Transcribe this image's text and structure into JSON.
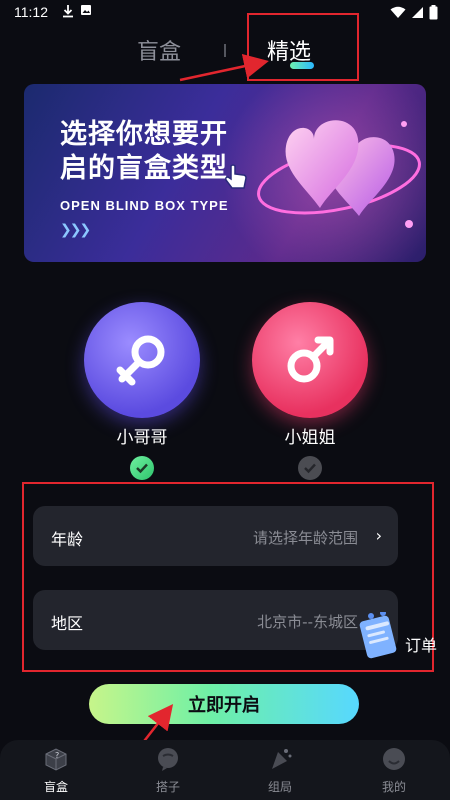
{
  "status_bar": {
    "time": "11:12",
    "icons": [
      "download-icon",
      "image-icon",
      "wifi-icon",
      "signal-icon",
      "battery-icon"
    ]
  },
  "top_tabs": {
    "blind_box": "盲盒",
    "selected": "精选",
    "active": "selected"
  },
  "banner": {
    "title_line1": "选择你想要开",
    "title_line2": "启的盲盒类型",
    "subtitle": "OPEN BLIND BOX TYPE"
  },
  "gender": {
    "male_label": "小哥哥",
    "female_label": "小姐姐",
    "selected": "male"
  },
  "form": {
    "age_label": "年龄",
    "age_placeholder": "请选择年龄范围",
    "region_label": "地区",
    "region_value": "北京市--东城区"
  },
  "orders_label": "订单",
  "start_button": "立即开启",
  "bottom_nav": [
    {
      "label": "盲盒",
      "icon": "box-icon",
      "active": true
    },
    {
      "label": "搭子",
      "icon": "chat-icon",
      "active": false
    },
    {
      "label": "组局",
      "icon": "party-icon",
      "active": false
    },
    {
      "label": "我的",
      "icon": "profile-icon",
      "active": false
    }
  ],
  "colors": {
    "background": "#0b0c12",
    "accent_red": "#e2262e",
    "male": "#6a5cf0",
    "female": "#ef4a73",
    "button_start": "#c7f58a",
    "button_end": "#57d8ff"
  }
}
